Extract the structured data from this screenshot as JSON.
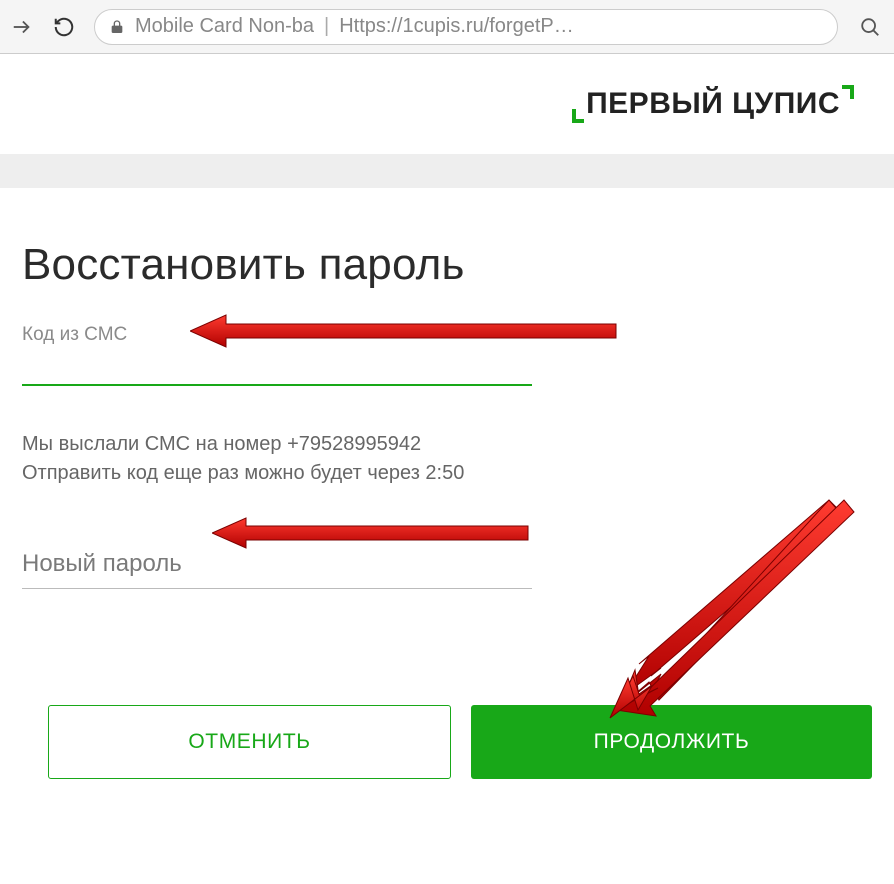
{
  "browser": {
    "page_title": "Mobile Card Non-ba",
    "url": "Https://1cupis.ru/forgetP…"
  },
  "logo": {
    "text": "ПЕРВЫЙ ЦУПИС"
  },
  "page": {
    "title": "Восстановить пароль",
    "sms": {
      "label": "Код из СМС",
      "value": ""
    },
    "helper_line1": "Мы выслали СМС на номер +79528995942",
    "helper_line2": "Отправить код еще раз можно будет через 2:50",
    "new_password_placeholder": "Новый пароль",
    "cancel_label": "ОТМЕНИТЬ",
    "continue_label": "ПРОДОЛЖИТЬ"
  }
}
